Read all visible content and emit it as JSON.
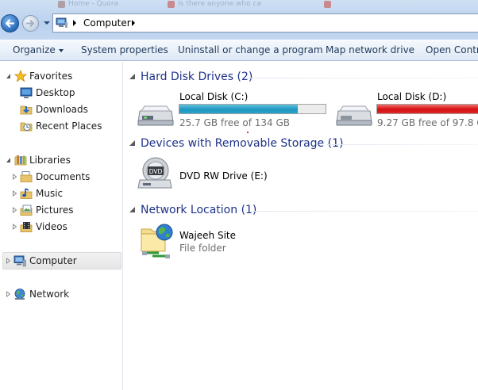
{
  "browser_tabs": [
    {
      "label": "Home - Quora"
    },
    {
      "label": "Is there anyone who ca"
    },
    {
      "label": ""
    }
  ],
  "address_bar": {
    "path": "Computer"
  },
  "command_bar": {
    "organize": "Organize",
    "system_properties": "System properties",
    "uninstall": "Uninstall or change a program",
    "map_network_drive": "Map network drive",
    "open_control_panel": "Open Contro"
  },
  "nav_pane": {
    "favorites": {
      "label": "Favorites",
      "items": [
        {
          "label": "Desktop"
        },
        {
          "label": "Downloads"
        },
        {
          "label": "Recent Places"
        }
      ]
    },
    "libraries": {
      "label": "Libraries",
      "items": [
        {
          "label": "Documents"
        },
        {
          "label": "Music"
        },
        {
          "label": "Pictures"
        },
        {
          "label": "Videos"
        }
      ]
    },
    "computer": {
      "label": "Computer",
      "selected": true
    },
    "network": {
      "label": "Network"
    }
  },
  "content": {
    "hard_disk_drives": {
      "title": "Hard Disk Drives (2)",
      "drives": [
        {
          "name": "Local Disk (C:)",
          "free_text": "25.7 GB free of 134 GB",
          "used_fraction": 0.81,
          "bar_color": "#1e97bf"
        },
        {
          "name": "Local Disk (D:)",
          "free_text": "9.27 GB free of 97.8 GB",
          "used_fraction": 0.91,
          "bar_color": "#d41010"
        }
      ]
    },
    "removable_storage": {
      "title": "Devices with Removable Storage (1)",
      "devices": [
        {
          "name": "DVD RW Drive (E:)",
          "icon_text": "DVD"
        }
      ]
    },
    "network_location": {
      "title": "Network Location (1)",
      "items": [
        {
          "name": "Wajeeh Site",
          "type": "File folder"
        }
      ]
    }
  },
  "colors": {
    "group_title": "#1e3287",
    "command_text": "#1e395b",
    "accent_blue": "#2668b6"
  }
}
